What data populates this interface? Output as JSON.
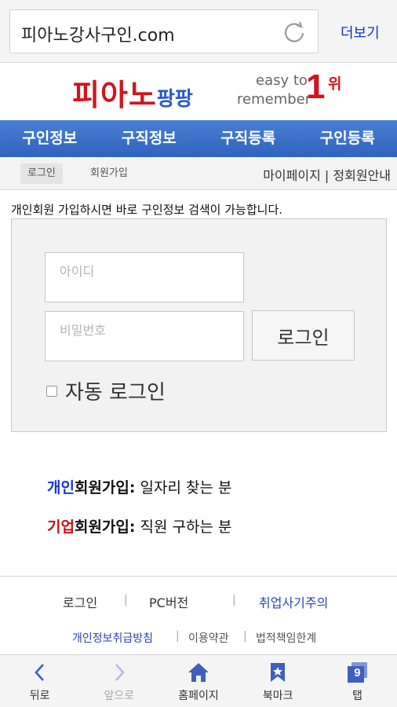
{
  "browser": {
    "url": "피아노강사구인.com",
    "more_label": "더보기"
  },
  "logo": {
    "main": "피아노",
    "sub": "팡팡",
    "slogan_line1": "easy to",
    "slogan_line2": "remember",
    "slogan_number": "1",
    "slogan_rank": "위"
  },
  "main_nav": {
    "items": [
      {
        "label": "구인정보"
      },
      {
        "label": "구직정보"
      },
      {
        "label": "구직등록"
      },
      {
        "label": "구인등록"
      }
    ]
  },
  "sub_nav": {
    "login_label": "로그인",
    "signup_label": "회원가입",
    "mypage_label": "마이페이지",
    "separator": "|",
    "member_guide_label": "정회원안내"
  },
  "notice": "개인회원 가입하시면 바로 구인정보 검색이 가능합니다.",
  "login_form": {
    "id_placeholder": "아이디",
    "pw_placeholder": "비밀번호",
    "submit_label": "로그인",
    "auto_login_label": "자동 로그인",
    "auto_login_checked": false
  },
  "join": {
    "personal_highlight": "개인",
    "personal_bold": "회원가입:",
    "personal_desc": "일자리 찾는 분",
    "company_highlight": "기업",
    "company_bold": "회원가입:",
    "company_desc": "직원 구하는 분"
  },
  "footer": {
    "login": "로그인",
    "pc_version": "PC버전",
    "fraud_warning": "취업사기주의",
    "privacy": "개인정보취급방침",
    "terms": "이용약관",
    "disclaimer": "법적책임한계",
    "sep": "|"
  },
  "toolbar": {
    "back": "뒤로",
    "forward": "앞으로",
    "home": "홈페이지",
    "bookmark": "북마크",
    "tabs": "탭",
    "tab_count": "9"
  },
  "colors": {
    "nav_blue": "#2f63bd",
    "logo_red": "#d0161c",
    "link_blue": "#1a35b8"
  }
}
